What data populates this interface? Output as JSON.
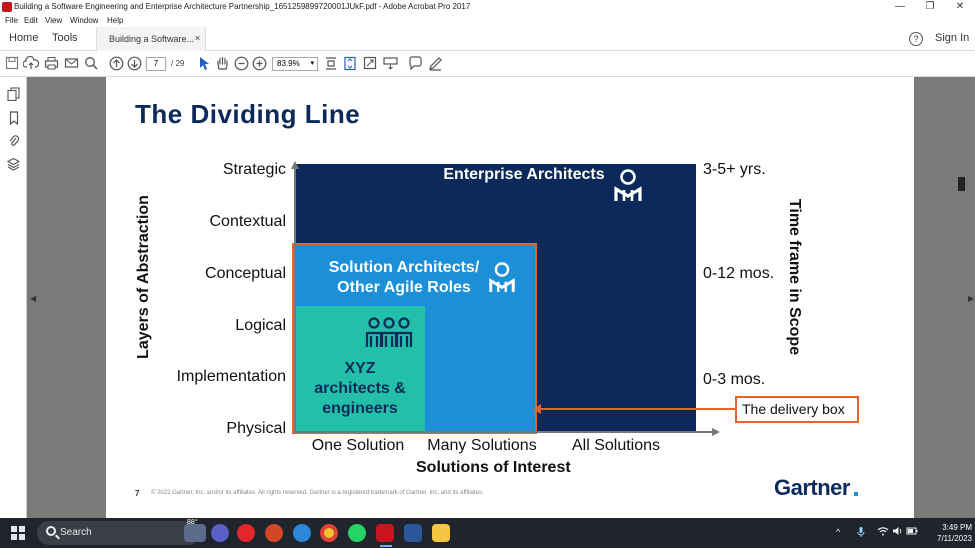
{
  "window": {
    "title": "Building a Software Engineering and Enterprise Architecture Partnership_1651259899720001JUkF.pdf - Adobe Acrobat Pro 2017",
    "minimize": "—",
    "maximize": "❐",
    "close": "✕"
  },
  "menu": [
    "File",
    "Edit",
    "View",
    "Window",
    "Help"
  ],
  "tabs": {
    "home": "Home",
    "tools": "Tools",
    "document": "Building a Software...",
    "document_close": "×",
    "help": "?",
    "sign_in": "Sign In"
  },
  "toolbar": {
    "page_current": "7",
    "page_total": "/ 29",
    "zoom": "83.9%"
  },
  "slide": {
    "title": "The Dividing Line",
    "y_levels": [
      "Strategic",
      "Contextual",
      "Conceptual",
      "Logical",
      "Implementation",
      "Physical"
    ],
    "x_categories": [
      "One Solution",
      "Many Solutions",
      "All Solutions"
    ],
    "y_axis_title": "Layers of Abstraction",
    "x_axis_title": "Solutions of Interest",
    "right_axis_title": "Time frame in Scope",
    "time_frames": [
      "3-5+ yrs.",
      "0-12 mos.",
      "0-3 mos."
    ],
    "boxes": {
      "enterprise": "Enterprise Architects",
      "solution_line1": "Solution Architects/",
      "solution_line2": "Other Agile Roles",
      "xyz_line1": "XYZ",
      "xyz_line2": "architects &",
      "xyz_line3": "engineers"
    },
    "callout": "The delivery box",
    "page_number": "7",
    "copyright": "© 2022 Gartner, Inc. and/or its affiliates. All rights reserved. Gartner is a registered trademark of Gartner, Inc. and its affiliates.",
    "brand": "Gartner",
    "colors": {
      "navy": "#0b2a5a",
      "blue": "#1b8fd8",
      "teal": "#22bfa9",
      "orange": "#e8622a"
    }
  },
  "taskbar": {
    "search_placeholder": "Search",
    "weather": "88°",
    "time": "3:49 PM",
    "date": "7/11/2023"
  }
}
